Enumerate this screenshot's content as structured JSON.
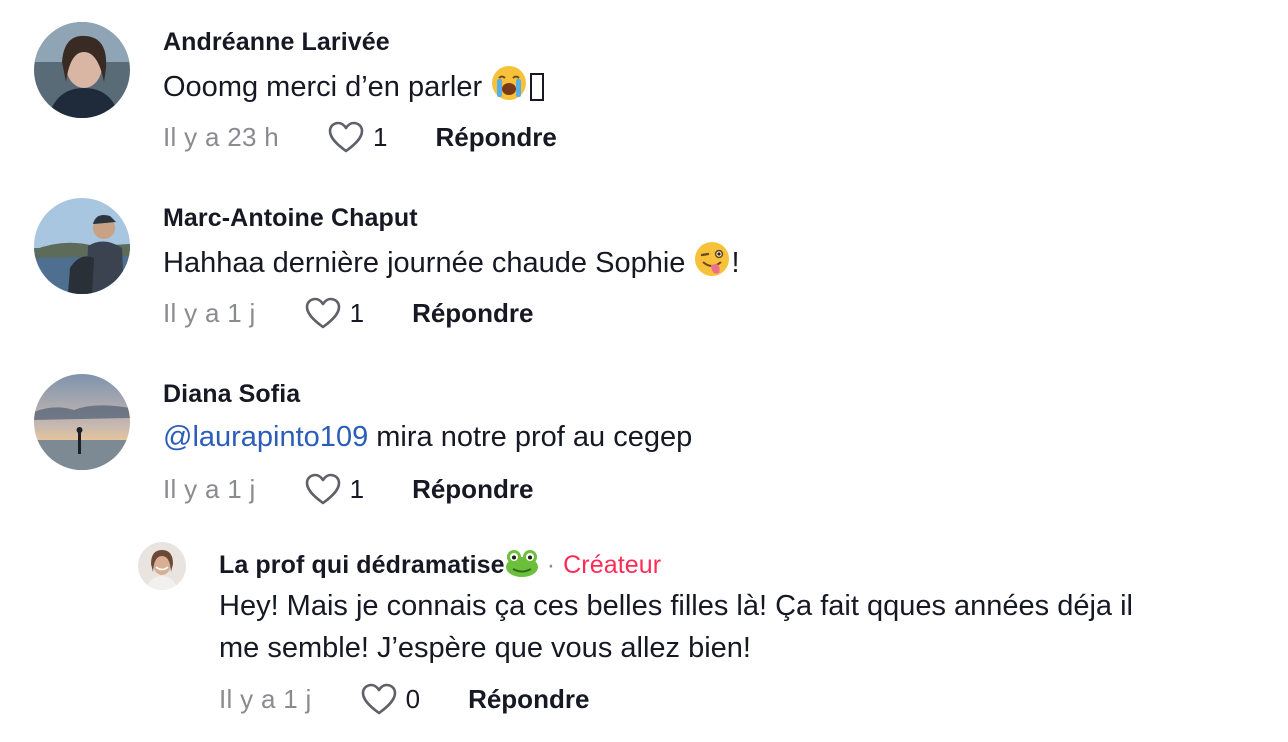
{
  "comments": [
    {
      "author": "Andréanne Larivée",
      "text": "Ooomg merci d’en parler",
      "emoji": "loudly-crying-face-emoji",
      "time": "Il y a 23 h",
      "likes": "1",
      "reply_label": "Répondre"
    },
    {
      "author": "Marc-Antoine Chaput",
      "text": "Hahhaa dernière journée chaude Sophie",
      "emoji": "winking-face-with-tongue-emoji",
      "text_suffix": "!",
      "time": "Il y a 1 j",
      "likes": "1",
      "reply_label": "Répondre"
    },
    {
      "author": "Diana Sofia",
      "mention": "@laurapinto109",
      "text": " mira notre prof au cegep",
      "time": "Il y a 1 j",
      "likes": "1",
      "reply_label": "Répondre"
    }
  ],
  "reply": {
    "author": "La prof qui dédramatise",
    "author_emoji": "frog-emoji",
    "separator": "·",
    "badge": "Créateur",
    "line1": "Hey! Mais je connais ça ces belles filles là! Ça fait qques années déja il",
    "line2": "me semble! J’espère que vous allez bien!",
    "time": "Il y a 1 j",
    "likes": "0",
    "reply_label": "Répondre"
  },
  "colors": {
    "text": "#161823",
    "muted": "#8a8b91",
    "mention": "#2b5db9",
    "creator_badge": "#fe2c55"
  },
  "icons": [
    "heart-outline-icon",
    "avatar-image"
  ]
}
